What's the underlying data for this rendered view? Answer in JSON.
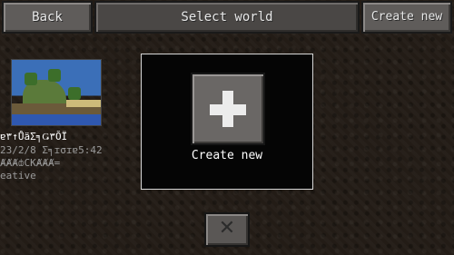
{
  "header": {
    "back_label": "Back",
    "title": "Select world",
    "create_label": "Create new"
  },
  "world": {
    "name": "ɐ٣↑ŮäΣ╕Ǥ٣ŎΪ",
    "date": "23/2/8 Σ╕ɪσɪɐ5:42",
    "seed": "ȺȺȺȸCKȺȺȺ=",
    "mode": "eative"
  },
  "center": {
    "create_label": "Create new",
    "plus_icon": "plus-icon"
  },
  "footer": {
    "close_icon": "close-icon"
  }
}
